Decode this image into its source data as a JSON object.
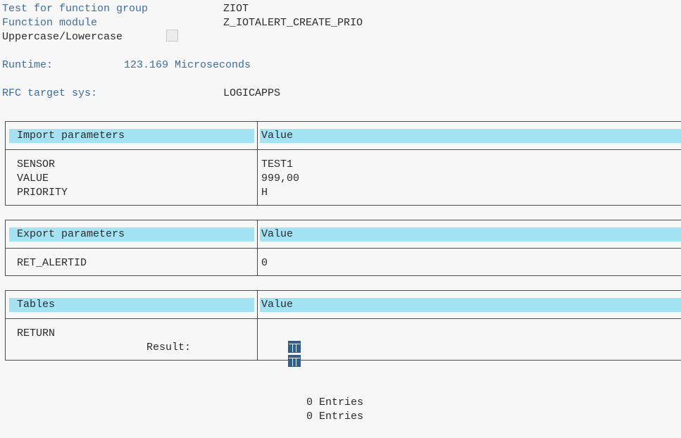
{
  "header": {
    "function_group_label": "Test for function group",
    "function_group_value": "ZIOT",
    "function_module_label": "Function module",
    "function_module_value": "Z_IOTALERT_CREATE_PRIO",
    "case_label": "Uppercase/Lowercase",
    "case_checked": false,
    "runtime_label": "Runtime:",
    "runtime_value": "123.169 Microseconds",
    "rfc_label": "RFC target sys:",
    "rfc_value": "LOGICAPPS"
  },
  "import": {
    "title": "Import parameters",
    "value_title": "Value",
    "rows": [
      {
        "name": "SENSOR",
        "value": "TEST1"
      },
      {
        "name": "VALUE",
        "value": "999,00"
      },
      {
        "name": "PRIORITY",
        "value": "H"
      }
    ]
  },
  "export": {
    "title": "Export parameters",
    "value_title": "Value",
    "rows": [
      {
        "name": "RET_ALERTID",
        "value": "0"
      }
    ]
  },
  "tables": {
    "title": "Tables",
    "value_title": "Value",
    "return_name": "RETURN",
    "return_value": "0 Entries",
    "result_label": "Result:",
    "result_value": "0 Entries",
    "icon": "table-icon"
  },
  "colors": {
    "header_bg": "#a4e3f4",
    "label_blue": "#3c6e9e"
  }
}
